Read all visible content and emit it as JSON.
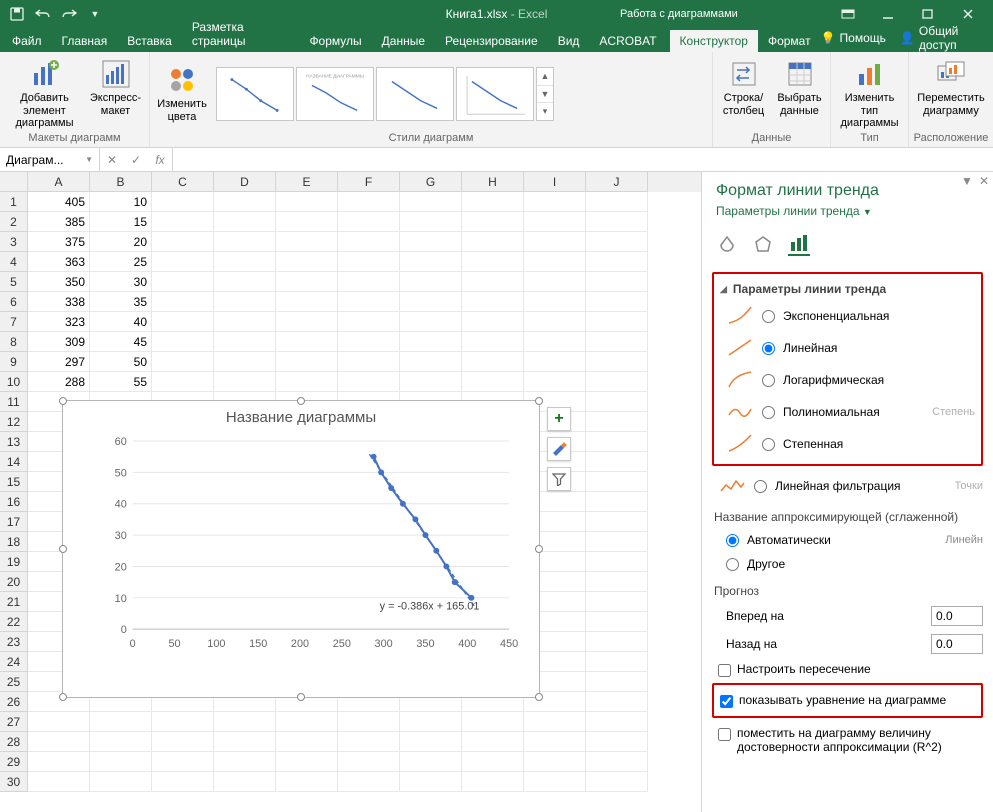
{
  "app": {
    "filename": "Книга1.xlsx",
    "suffix": " - Excel",
    "contextual_title": "Работа с диаграммами"
  },
  "tabs": {
    "file": "Файл",
    "home": "Главная",
    "insert": "Вставка",
    "layout": "Разметка страницы",
    "formulas": "Формулы",
    "data": "Данные",
    "review": "Рецензирование",
    "view": "Вид",
    "acrobat": "ACROBAT",
    "ctx_design": "Конструктор",
    "ctx_format": "Формат",
    "help": "Помощь",
    "share": "Общий доступ"
  },
  "ribbon": {
    "groups": {
      "layouts": "Макеты диаграмм",
      "styles": "Стили диаграмм",
      "data": "Данные",
      "type": "Тип",
      "location": "Расположение"
    },
    "buttons": {
      "add_element": "Добавить элемент диаграммы",
      "express_layout": "Экспресс-макет",
      "change_colors": "Изменить цвета",
      "switch_rowcol": "Строка/ столбец",
      "select_data": "Выбрать данные",
      "change_type": "Изменить тип диаграммы",
      "move_chart": "Переместить диаграмму"
    }
  },
  "namebox": "Диаграм...",
  "columns": [
    "A",
    "B",
    "C",
    "D",
    "E",
    "F",
    "G",
    "H",
    "I",
    "J"
  ],
  "rownums": [
    1,
    2,
    3,
    4,
    5,
    6,
    7,
    8,
    9,
    10,
    11,
    12,
    13,
    14,
    15,
    16,
    17,
    18,
    19,
    20,
    21,
    22,
    23,
    24,
    25,
    26,
    27,
    28,
    29,
    30
  ],
  "cells": {
    "A": [
      405,
      385,
      375,
      363,
      350,
      338,
      323,
      309,
      297,
      288
    ],
    "B": [
      10,
      15,
      20,
      25,
      30,
      35,
      40,
      45,
      50,
      55
    ]
  },
  "chart_data": {
    "type": "scatter",
    "title": "Название диаграммы",
    "x": [
      405,
      385,
      375,
      363,
      350,
      338,
      323,
      309,
      297,
      288
    ],
    "y": [
      10,
      15,
      20,
      25,
      30,
      35,
      40,
      45,
      50,
      55
    ],
    "xlim": [
      0,
      450
    ],
    "ylim": [
      0,
      60
    ],
    "xticks": [
      0,
      50,
      100,
      150,
      200,
      250,
      300,
      350,
      400,
      450
    ],
    "yticks": [
      0,
      10,
      20,
      30,
      40,
      50,
      60
    ],
    "trendline": {
      "type": "linear",
      "slope": -0.386,
      "intercept": 165.01
    },
    "equation_label": "y = -0.386x + 165.01"
  },
  "pane": {
    "title": "Формат линии тренда",
    "subtitle": "Параметры линии тренда",
    "section_options": "Параметры линии тренда",
    "trend_types": {
      "exp": "Экспоненциальная",
      "lin": "Линейная",
      "log": "Логарифмическая",
      "poly": "Полиномиальная",
      "pow": "Степенная",
      "movavg": "Линейная фильтрация"
    },
    "poly_degree_lbl": "Степень",
    "movavg_points_lbl": "Точки",
    "name_heading": "Название аппроксимирующей (сглаженной)",
    "name_auto": "Автоматически",
    "name_auto_val": "Линейн",
    "name_other": "Другое",
    "forecast": "Прогноз",
    "fwd": "Вперед на",
    "bwd": "Назад на",
    "fwd_val": "0.0",
    "bwd_val": "0.0",
    "set_intercept": "Настроить пересечение",
    "show_eq": "показывать уравнение на диаграмме",
    "show_r2": "поместить на диаграмму величину достоверности аппроксимации (R^2)"
  }
}
